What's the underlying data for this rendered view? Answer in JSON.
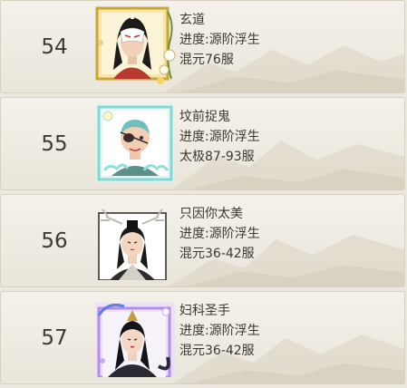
{
  "rows": [
    {
      "rank": "54",
      "name": "玄道",
      "progress": "进度:源阶浮生",
      "server": "混元76服",
      "avatar": "white-masked-warrior-gold-frame-icon"
    },
    {
      "rank": "55",
      "name": "坟前捉鬼",
      "progress": "进度:源阶浮生",
      "server": "太极87-93服",
      "avatar": "eyepatch-monk-cloud-frame-icon"
    },
    {
      "rank": "56",
      "name": "只因你太美",
      "progress": "进度:源阶浮生",
      "server": "混元36-42服",
      "avatar": "antlered-priest-avatar-icon"
    },
    {
      "rank": "57",
      "name": "妇科圣手",
      "progress": "进度:源阶浮生",
      "server": "混元36-42服",
      "avatar": "sorceress-purple-glow-frame-icon"
    }
  ]
}
